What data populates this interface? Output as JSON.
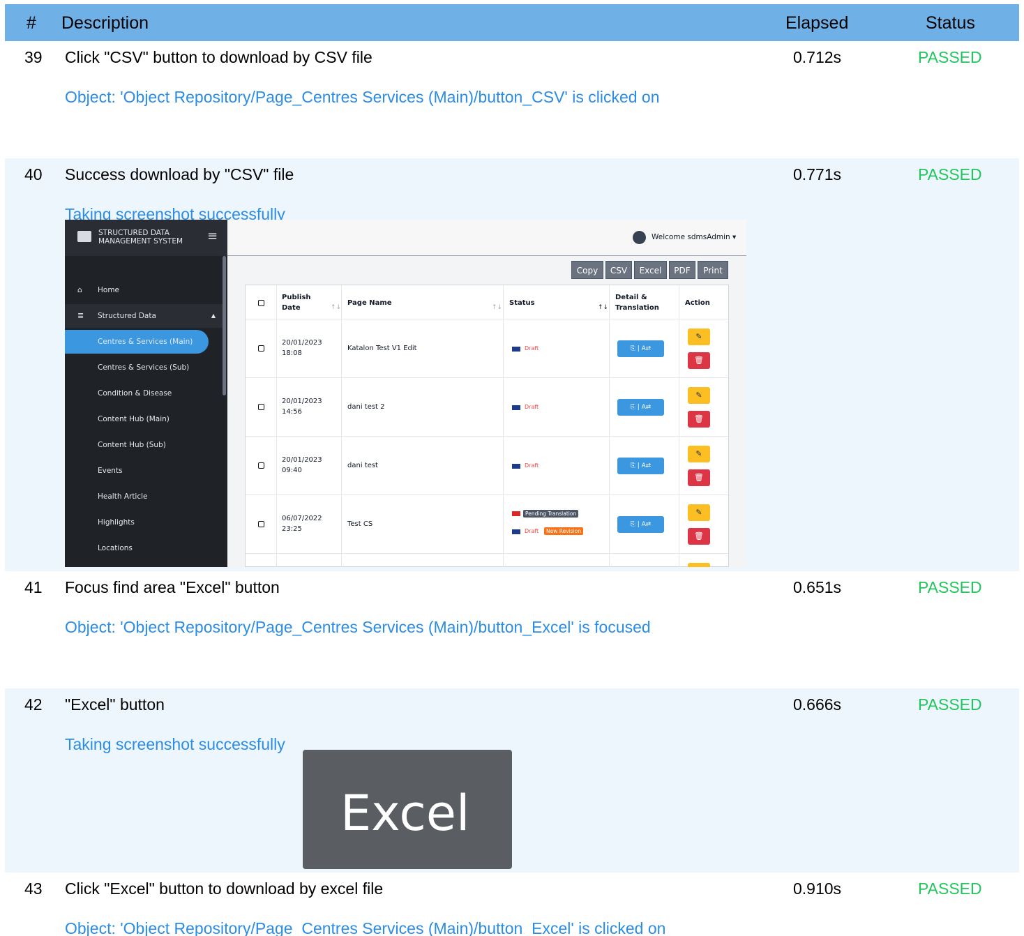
{
  "header": {
    "num": "#",
    "description": "Description",
    "elapsed": "Elapsed",
    "status": "Status"
  },
  "steps": [
    {
      "num": "39",
      "description": "Click \"CSV\" button to download by CSV file",
      "elapsed": "0.712s",
      "status": "PASSED",
      "log": "Object: 'Object Repository/Page_Centres  Services (Main)/button_CSV' is clicked on"
    },
    {
      "num": "40",
      "description": "Success download by \"CSV\" file",
      "elapsed": "0.771s",
      "status": "PASSED",
      "log": "Taking screenshot successfully"
    },
    {
      "num": "41",
      "description": "Focus find area \"Excel\" button",
      "elapsed": "0.651s",
      "status": "PASSED",
      "log": "Object: 'Object Repository/Page_Centres  Services (Main)/button_Excel' is focused"
    },
    {
      "num": "42",
      "description": "\"Excel\" button",
      "elapsed": "0.666s",
      "status": "PASSED",
      "log": "Taking screenshot successfully"
    },
    {
      "num": "43",
      "description": "Click \"Excel\" button to download by excel file",
      "elapsed": "0.910s",
      "status": "PASSED",
      "log": "Object: 'Object Repository/Page_Centres  Services (Main)/button_Excel' is clicked on"
    }
  ],
  "screenshot1": {
    "brand": "STRUCTURED DATA MANAGEMENT SYSTEM",
    "welcome": "Welcome sdmsAdmin",
    "sidebar": [
      "Home",
      "Structured Data",
      "Centres & Services (Main)",
      "Centres & Services (Sub)",
      "Condition & Disease",
      "Content Hub (Main)",
      "Content Hub (Sub)",
      "Events",
      "Health Article",
      "Highlights",
      "Locations"
    ],
    "buttons": [
      "Copy",
      "CSV",
      "Excel",
      "PDF",
      "Print"
    ],
    "columns": {
      "publish_date": "Publish Date",
      "page_name": "Page Name",
      "status": "Status",
      "detail": "Detail & Translation",
      "action": "Action"
    },
    "rows": [
      {
        "date": "20/01/2023",
        "time": "18:08",
        "name": "Katalon Test V1 Edit",
        "status": "Draft"
      },
      {
        "date": "20/01/2023",
        "time": "14:56",
        "name": "dani test 2",
        "status": "Draft"
      },
      {
        "date": "20/01/2023",
        "time": "09:40",
        "name": "dani test",
        "status": "Draft"
      },
      {
        "date": "06/07/2022",
        "time": "23:25",
        "name": "Test CS",
        "status": "Draft",
        "pending": "Pending Translation",
        "revision": "New Revision"
      }
    ]
  },
  "screenshot2": {
    "label": "Excel"
  },
  "colors": {
    "header": "#6fb0e6",
    "passed": "#22c55e",
    "log": "#2a8ce5",
    "shaded": "#eef6fd"
  }
}
